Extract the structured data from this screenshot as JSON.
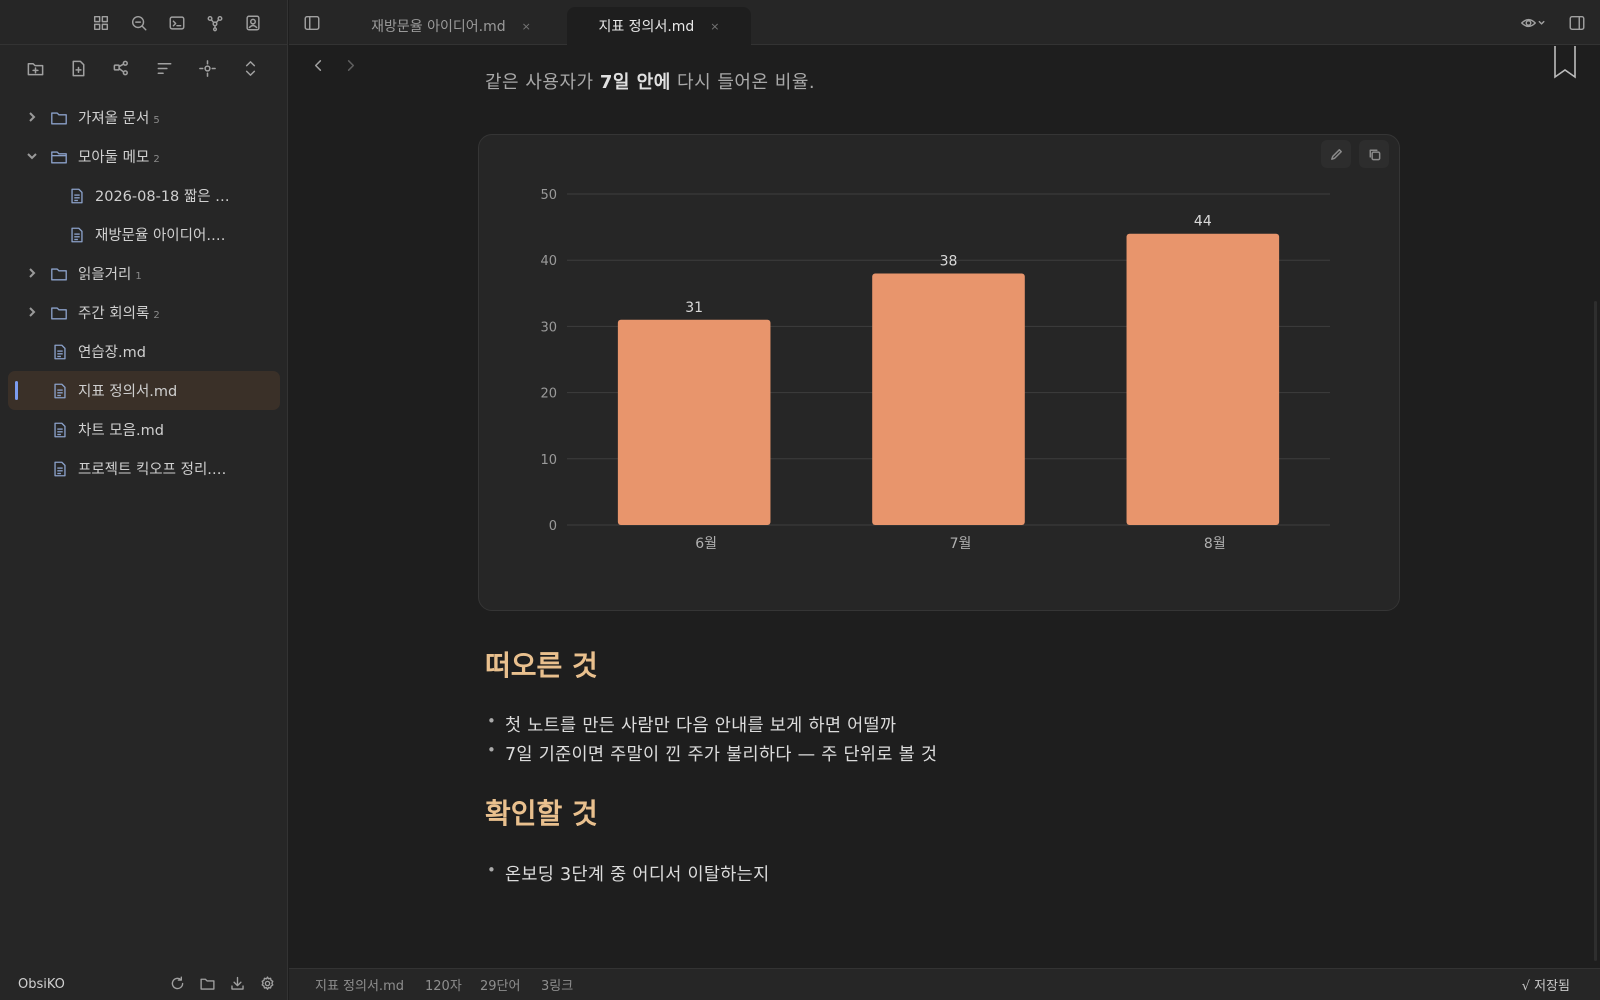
{
  "sidebar": {
    "ribbon_icons": [
      "grid-icon",
      "search-icon",
      "terminal-icon",
      "graph-icon",
      "user-icon"
    ],
    "nav_actions": [
      "new-folder-icon",
      "new-note-icon",
      "graph-view-icon",
      "sort-icon",
      "locate-icon",
      "collapse-icon"
    ],
    "tree": [
      {
        "label": "가져올 문서",
        "count": "5",
        "type": "folder",
        "expanded": false
      },
      {
        "label": "모아둘 메모",
        "count": "2",
        "type": "folder",
        "expanded": true
      },
      {
        "label": "2026-08-18 짧은 …",
        "type": "file",
        "nested": true
      },
      {
        "label": "재방문율 아이디어.…",
        "type": "file",
        "nested": true
      },
      {
        "label": "읽을거리",
        "count": "1",
        "type": "folder",
        "expanded": false
      },
      {
        "label": "주간 회의록",
        "count": "2",
        "type": "folder",
        "expanded": false
      },
      {
        "label": "연습장.md",
        "type": "file"
      },
      {
        "label": "지표 정의서.md",
        "type": "file",
        "active": true
      },
      {
        "label": "차트 모음.md",
        "type": "file"
      },
      {
        "label": "프로젝트 킥오프 정리.…",
        "type": "file"
      }
    ],
    "vault_name": "ObsiKO"
  },
  "tabs": [
    {
      "label": "재방문율 아이디어.md",
      "close": "×",
      "active": false
    },
    {
      "label": "지표 정의서.md",
      "close": "×",
      "active": true
    }
  ],
  "editor": {
    "lead_before": "같은 사용자가 ",
    "lead_bold": "7일 안에",
    "lead_after": " 다시 들어온 비율.",
    "heading1": "떠오른 것",
    "bullets1": [
      "첫 노트를 만든 사람만 다음 안내를 보게 하면 어떨까",
      "7일 기준이면 주말이 낀 주가 불리하다 — 주 단위로 볼 것"
    ],
    "heading2": "확인할 것",
    "bullets2": [
      "온보딩 3단계 중 어디서 이탈하는지"
    ]
  },
  "chart_data": {
    "type": "bar",
    "categories": [
      "6월",
      "7월",
      "8월"
    ],
    "values": [
      31,
      38,
      44
    ],
    "ylim": [
      0,
      50
    ],
    "yticks": [
      0,
      10,
      20,
      30,
      40,
      50
    ],
    "grid": true,
    "bar_color": "#e8956c",
    "data_labels": true
  },
  "status": {
    "file": "지표 정의서.md",
    "chars": "120자",
    "words": "29단어",
    "links": "3링크",
    "saved": "√ 저장됨"
  },
  "colors": {
    "heading": "#e9c08e",
    "accent": "#7b9cf0",
    "active_row": "#3a3028"
  }
}
